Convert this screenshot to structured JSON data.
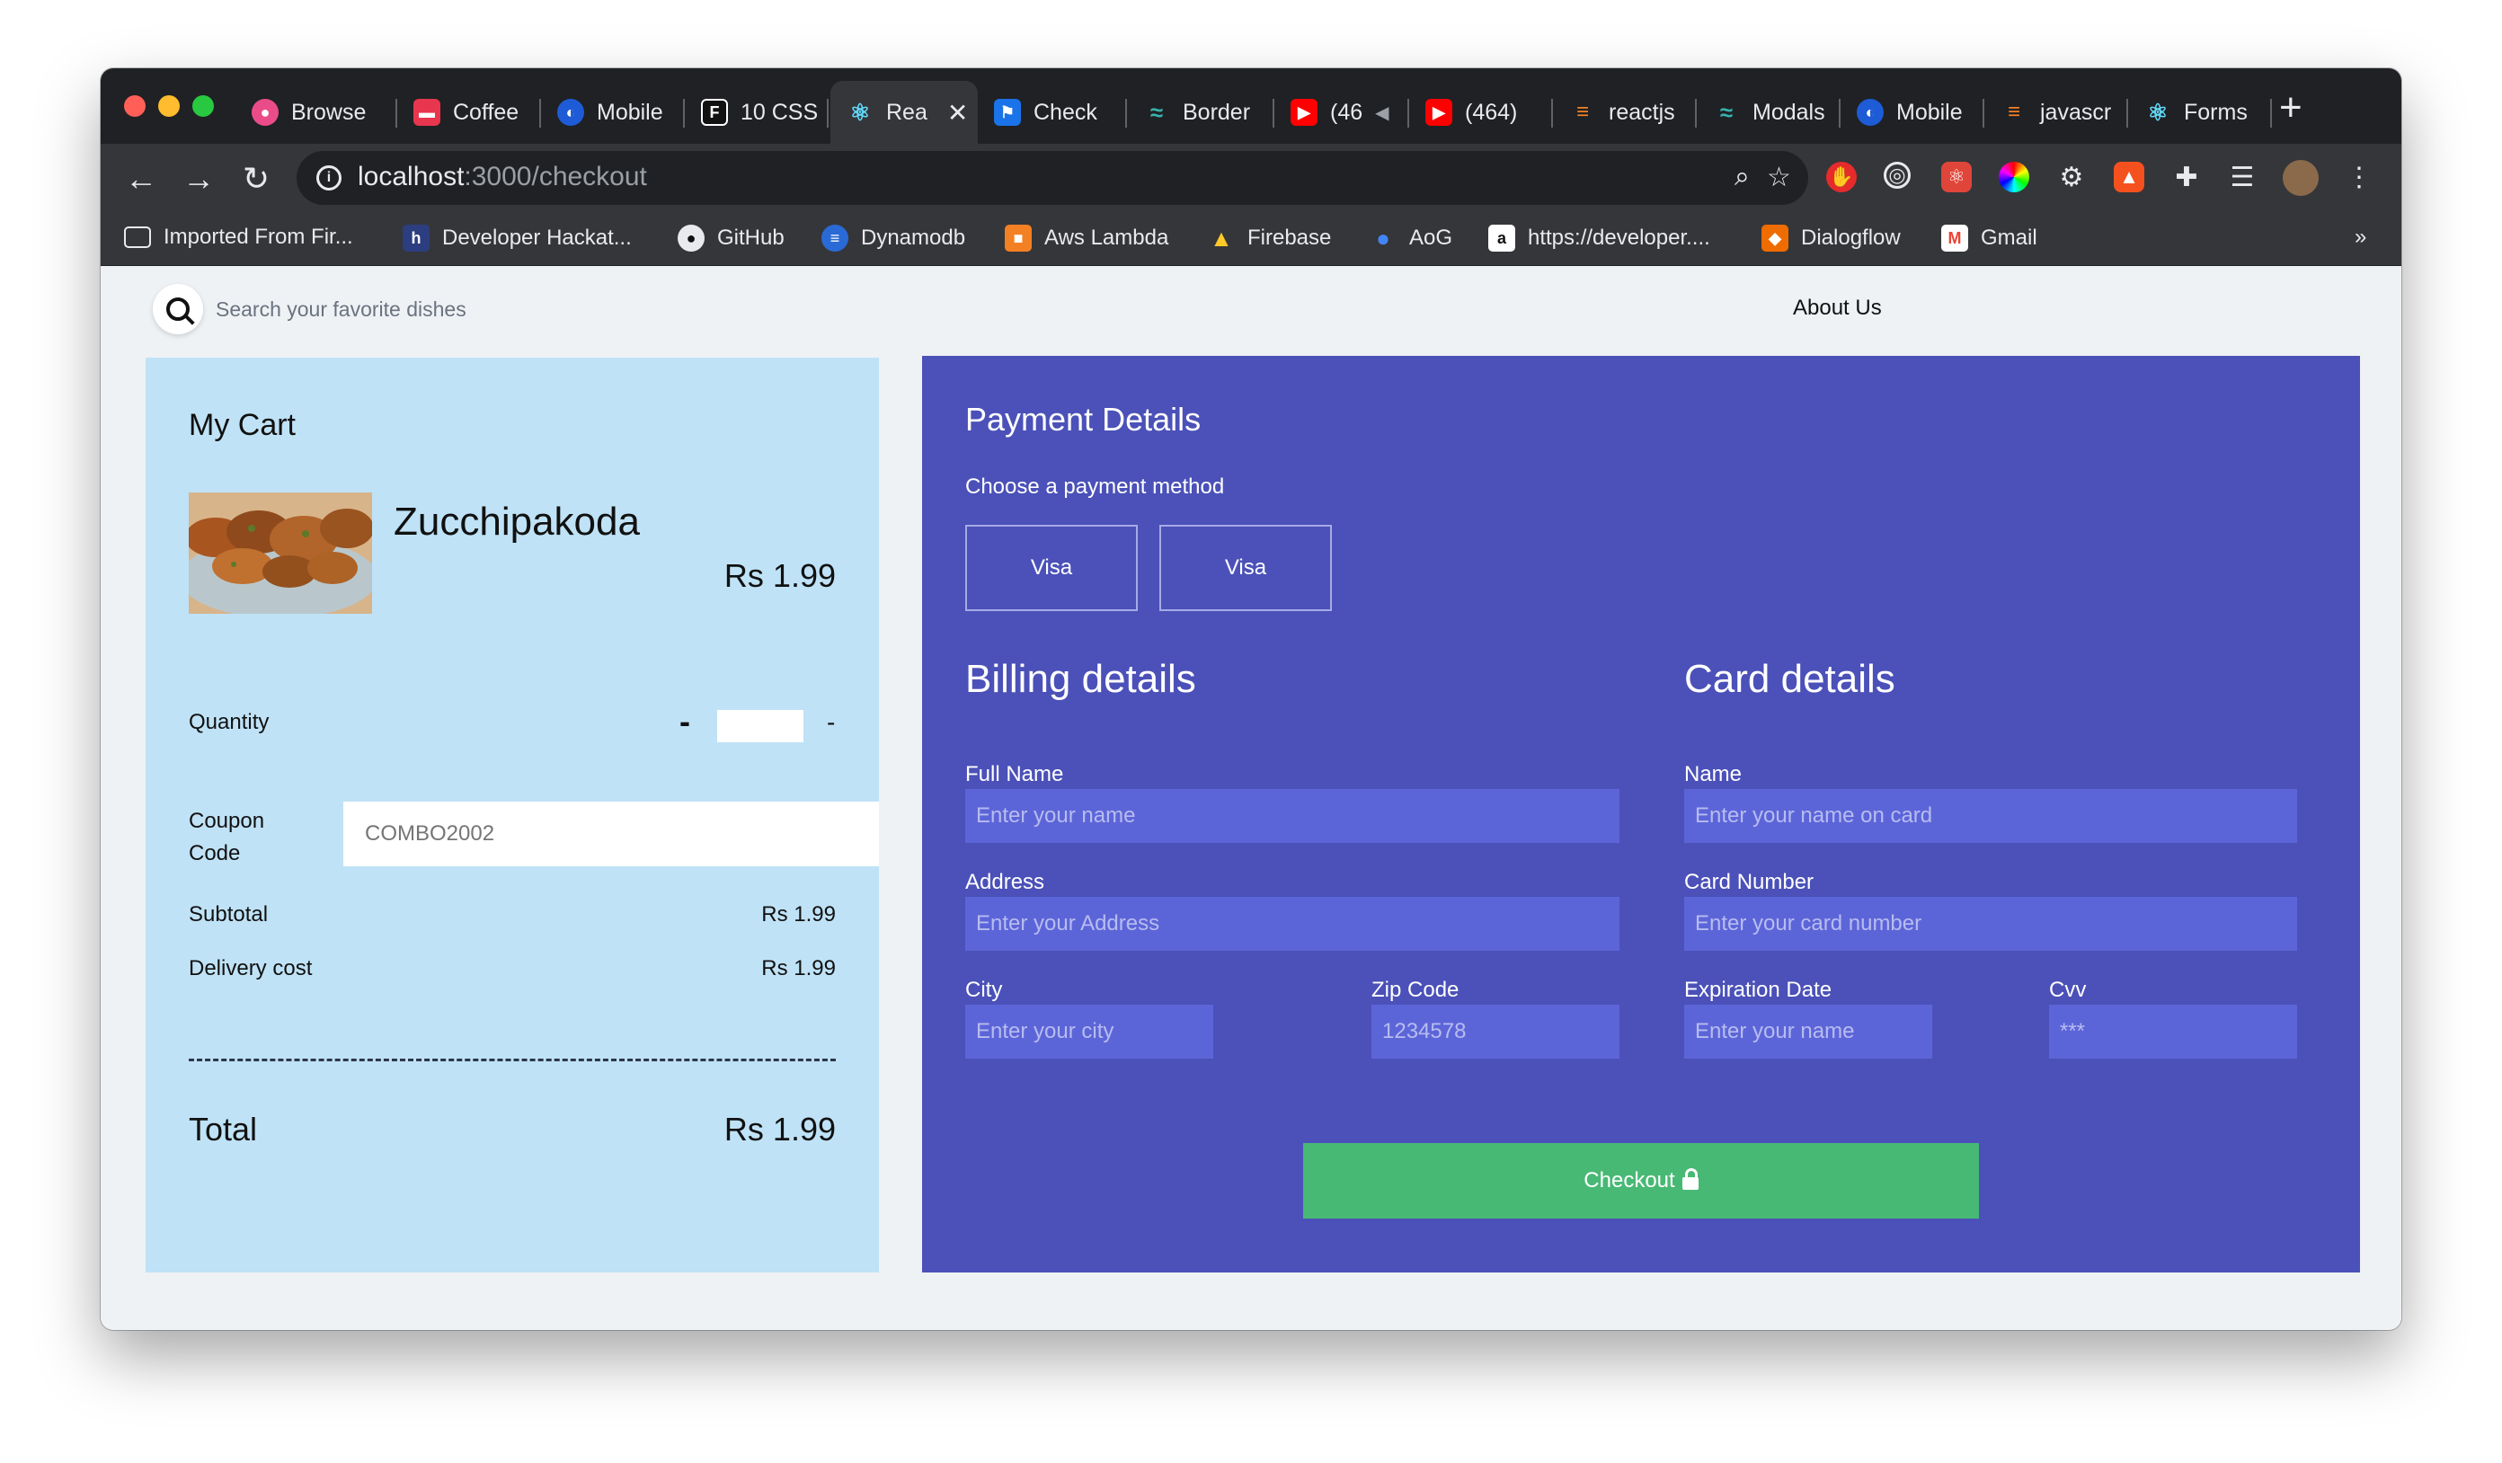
{
  "browser": {
    "tabs": [
      {
        "label": "Browse",
        "icon": "dribbble-icon",
        "color": "#ea4c89"
      },
      {
        "label": "Coffee",
        "icon": "coffee-icon",
        "color": "#e8364f"
      },
      {
        "label": "Mobile",
        "icon": "mobile-icon",
        "color": "#1e5bd6"
      },
      {
        "label": "10 CSS",
        "icon": "framer-icon",
        "color": "#111111"
      },
      {
        "label": "Rea",
        "icon": "react-icon",
        "color": "#61dafb",
        "active": true
      },
      {
        "label": "Check",
        "icon": "flag-icon",
        "color": "#1a73e8"
      },
      {
        "label": "Border",
        "icon": "tailwind-icon",
        "color": "#38b2ac"
      },
      {
        "label": "(46",
        "icon": "youtube-icon",
        "color": "#ff0000"
      },
      {
        "label": "(464)",
        "icon": "youtube-icon",
        "color": "#ff0000"
      },
      {
        "label": "reactjs",
        "icon": "stackoverflow-icon",
        "color": "#f48024"
      },
      {
        "label": "Modals",
        "icon": "tailwind-icon",
        "color": "#38b2ac"
      },
      {
        "label": "Mobile",
        "icon": "mobile-icon",
        "color": "#1e5bd6"
      },
      {
        "label": "javascr",
        "icon": "stackoverflow-icon",
        "color": "#f48024"
      },
      {
        "label": "Forms",
        "icon": "react-icon",
        "color": "#61dafb"
      }
    ],
    "url_host": "localhost",
    "url_path": ":3000/checkout",
    "bookmarks": [
      {
        "label": "Imported From Fir...",
        "icon": "folder-icon"
      },
      {
        "label": "Developer Hackat...",
        "icon": "hackathon-icon"
      },
      {
        "label": "GitHub",
        "icon": "github-icon"
      },
      {
        "label": "Dynamodb",
        "icon": "dynamodb-icon"
      },
      {
        "label": "Aws Lambda",
        "icon": "aws-icon"
      },
      {
        "label": "Firebase",
        "icon": "firebase-icon"
      },
      {
        "label": "AoG",
        "icon": "assistant-icon"
      },
      {
        "label": "https://developer....",
        "icon": "amazon-icon"
      },
      {
        "label": "Dialogflow",
        "icon": "dialogflow-icon"
      },
      {
        "label": "Gmail",
        "icon": "gmail-icon"
      }
    ],
    "bookmarks_overflow": "»"
  },
  "header": {
    "search_placeholder": "Search your favorite dishes",
    "about": "About Us"
  },
  "cart": {
    "title": "My Cart",
    "dish": "Zucchipakoda",
    "price": "Rs 1.99",
    "quantity_label": "Quantity",
    "qty_minus": "-",
    "qty_plus": "-",
    "coupon_label": "Coupon Code",
    "coupon_placeholder": "COMBO2002",
    "subtotal_label": "Subtotal",
    "subtotal_value": "Rs 1.99",
    "delivery_label": "Delivery cost",
    "delivery_value": "Rs 1.99",
    "total_label": "Total",
    "total_value": "Rs 1.99"
  },
  "payment": {
    "title": "Payment Details",
    "subtitle": "Choose a payment method",
    "methods": [
      "Visa",
      "Visa"
    ],
    "billing": {
      "title": "Billing details",
      "full_name_label": "Full Name",
      "full_name_placeholder": "Enter your name",
      "address_label": "Address",
      "address_placeholder": "Enter your Address",
      "city_label": "City",
      "city_placeholder": "Enter your city",
      "zip_label": "Zip Code",
      "zip_placeholder": "1234578"
    },
    "card": {
      "title": "Card details",
      "name_label": "Name",
      "name_placeholder": "Enter your name on card",
      "number_label": "Card Number",
      "number_placeholder": "Enter your card number",
      "expiry_label": "Expiration Date",
      "expiry_placeholder": "Enter your name",
      "cvv_label": "Cvv",
      "cvv_placeholder": "***"
    },
    "checkout_label": "Checkout"
  },
  "colors": {
    "cart_bg": "#bfe2f6",
    "payment_bg": "#4b51b8",
    "input_bg": "#5c65d8",
    "checkout_bg": "#48b975"
  }
}
